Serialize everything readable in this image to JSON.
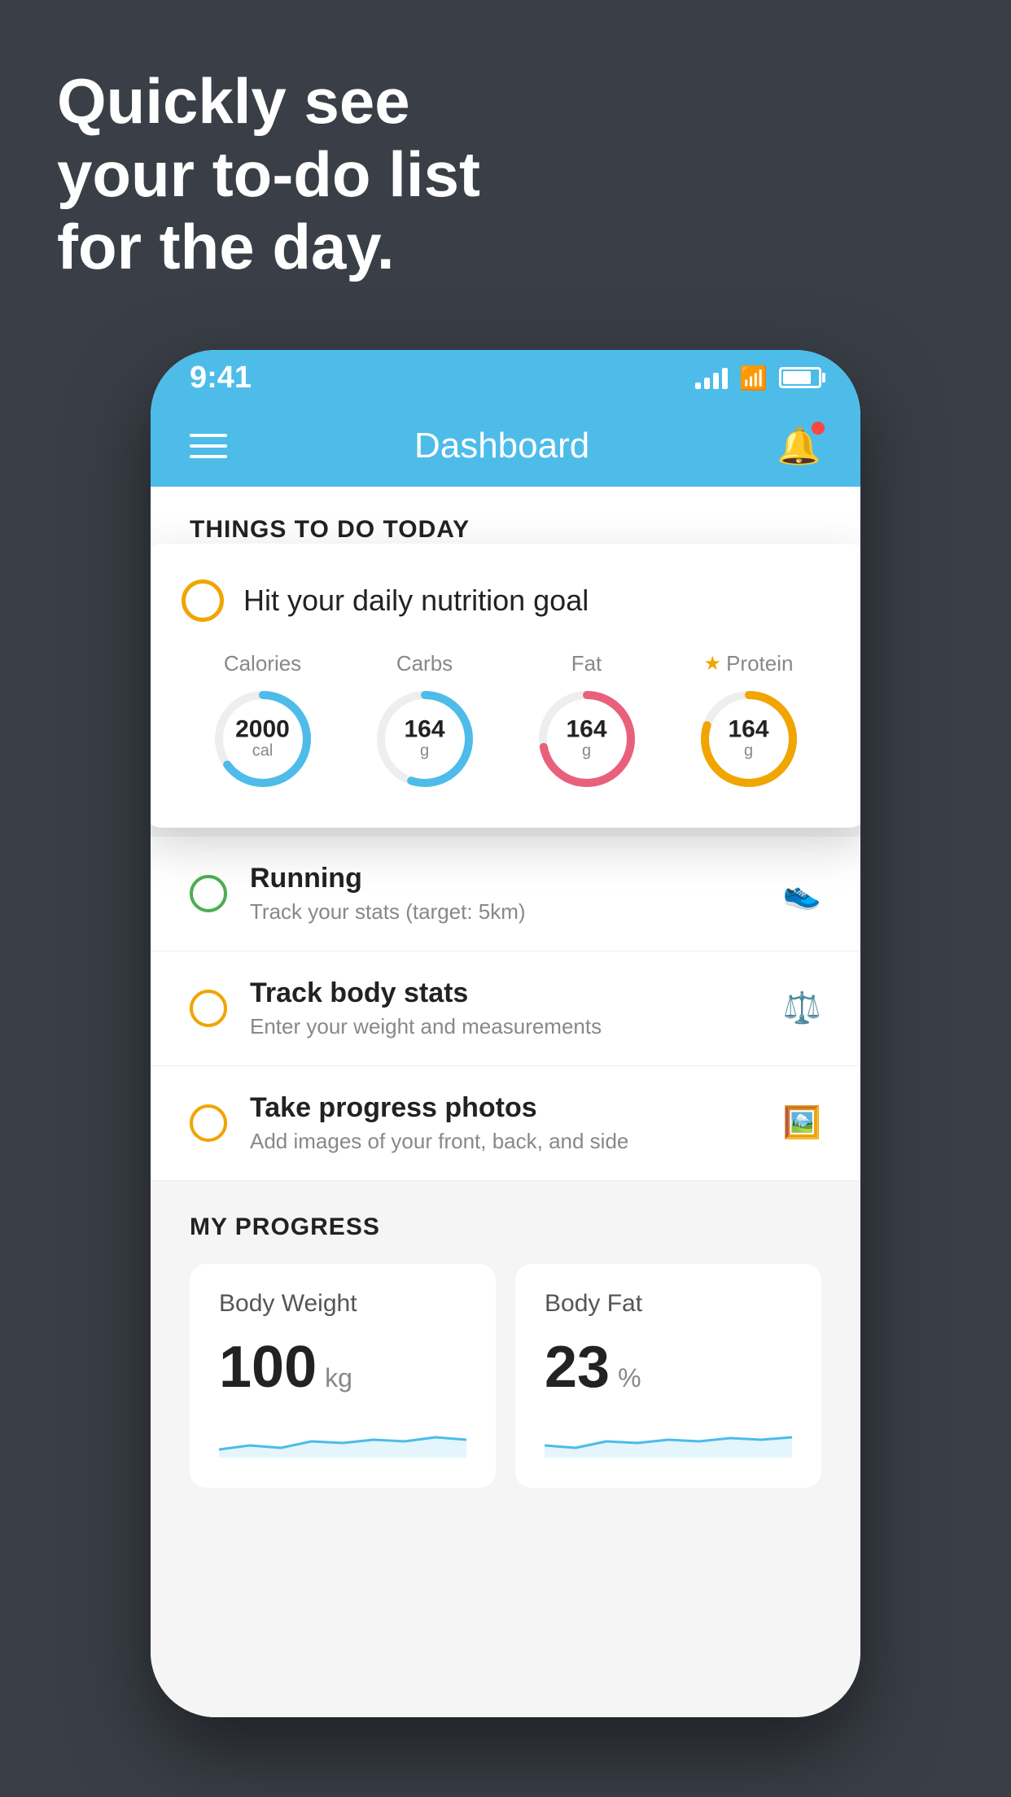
{
  "headline": {
    "line1": "Quickly see",
    "line2": "your to-do list",
    "line3": "for the day."
  },
  "status_bar": {
    "time": "9:41"
  },
  "header": {
    "title": "Dashboard"
  },
  "things_section": {
    "label": "THINGS TO DO TODAY"
  },
  "nutrition_card": {
    "title": "Hit your daily nutrition goal",
    "stats": [
      {
        "label": "Calories",
        "value": "2000",
        "unit": "cal",
        "color": "#4dbce9",
        "pct": 65
      },
      {
        "label": "Carbs",
        "value": "164",
        "unit": "g",
        "color": "#4dbce9",
        "pct": 55
      },
      {
        "label": "Fat",
        "value": "164",
        "unit": "g",
        "color": "#e9607a",
        "pct": 72
      },
      {
        "label": "Protein",
        "value": "164",
        "unit": "g",
        "color": "#f0a500",
        "pct": 80,
        "star": true
      }
    ]
  },
  "todo_items": [
    {
      "id": "running",
      "title": "Running",
      "subtitle": "Track your stats (target: 5km)",
      "circle_color": "green",
      "icon": "👟"
    },
    {
      "id": "body_stats",
      "title": "Track body stats",
      "subtitle": "Enter your weight and measurements",
      "circle_color": "yellow",
      "icon": "⚖️"
    },
    {
      "id": "progress_photo",
      "title": "Take progress photos",
      "subtitle": "Add images of your front, back, and side",
      "circle_color": "yellow",
      "icon": "🖼️"
    }
  ],
  "progress_section": {
    "label": "MY PROGRESS",
    "cards": [
      {
        "id": "body_weight",
        "title": "Body Weight",
        "value": "100",
        "unit": "kg"
      },
      {
        "id": "body_fat",
        "title": "Body Fat",
        "value": "23",
        "unit": "%"
      }
    ]
  }
}
